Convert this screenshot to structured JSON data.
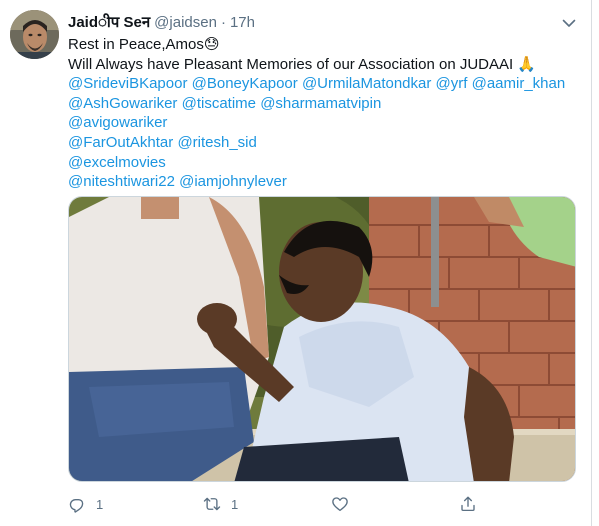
{
  "tweet": {
    "display_name": "Jaidीप Seन",
    "handle": "@jaidsen",
    "separator": "·",
    "time": "17h",
    "text_line1": "Rest in Peace,Amos",
    "text_line1_emoji": "😓",
    "text_line2": "Will Always have Pleasant Memories of our Association on JUDAAI",
    "text_line2_emoji": "🙏",
    "mentions_line1": [
      "@SrideviBKapoor",
      "@BoneyKapoor",
      "@UrmilaMatondkar",
      "@yrf",
      "@aamir_khan"
    ],
    "mentions_line2": [
      "@AshGowariker",
      "@tiscatime",
      "@sharmamatvipin"
    ],
    "mentions_line3": [
      "@avigowariker"
    ],
    "mentions_line4": [
      "@FarOutAkhtar",
      "@ritesh_sid"
    ],
    "mentions_line5": [
      "@excelmovies"
    ],
    "mentions_line6": [
      "@niteshtiwari22",
      "@iamjohnylever"
    ]
  },
  "actions": {
    "reply_count": "1",
    "retweet_count": "1",
    "like_count": "",
    "share_count": ""
  },
  "icons": {
    "caret": "chevron-down-icon",
    "reply": "reply-icon",
    "retweet": "retweet-icon",
    "like": "heart-icon",
    "share": "share-icon"
  },
  "colors": {
    "link": "#1b95e0",
    "secondary_text": "#5b7083",
    "primary_text": "#0f1419"
  }
}
